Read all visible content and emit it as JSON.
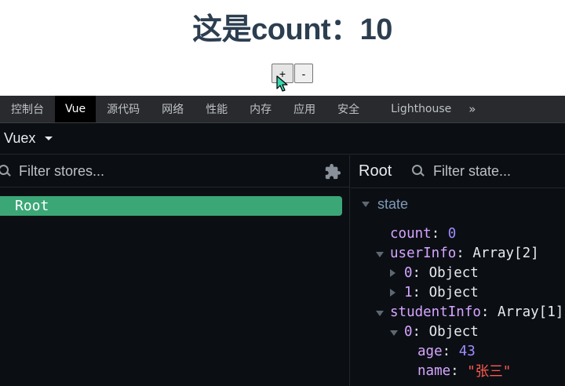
{
  "app": {
    "title": "这是count：10",
    "increment_label": "+",
    "decrement_label": "-"
  },
  "devtools_tabs": [
    {
      "label": "控制台"
    },
    {
      "label": "Vue"
    },
    {
      "label": "源代码"
    },
    {
      "label": "网络"
    },
    {
      "label": "性能"
    },
    {
      "label": "内存"
    },
    {
      "label": "应用"
    },
    {
      "label": "安全"
    },
    {
      "label": "Lighthouse"
    },
    {
      "label": "»"
    }
  ],
  "vue": {
    "plugin_selector": "Vuex",
    "stores_filter_placeholder": "Filter stores...",
    "stores": [
      {
        "label": "Root"
      }
    ],
    "inspector_title": "Root",
    "state_filter_placeholder": "Filter state...",
    "state_section": "state",
    "state": {
      "count_key": "count",
      "count_value": "0",
      "userInfo_key": "userInfo",
      "userInfo_value": "Array[2]",
      "userInfo_0_key": "0",
      "userInfo_0_value": "Object",
      "userInfo_1_key": "1",
      "userInfo_1_value": "Object",
      "studentInfo_key": "studentInfo",
      "studentInfo_value": "Array[1]",
      "studentInfo_0_key": "0",
      "studentInfo_0_value": "Object",
      "age_key": "age",
      "age_value": "43",
      "name_key": "name",
      "name_value": "\"张三\""
    }
  },
  "colors": {
    "accent_green": "#3ba776",
    "key_purple": "#d7a5ff",
    "number": "#9f8cff",
    "string": "#ff5a4e"
  }
}
